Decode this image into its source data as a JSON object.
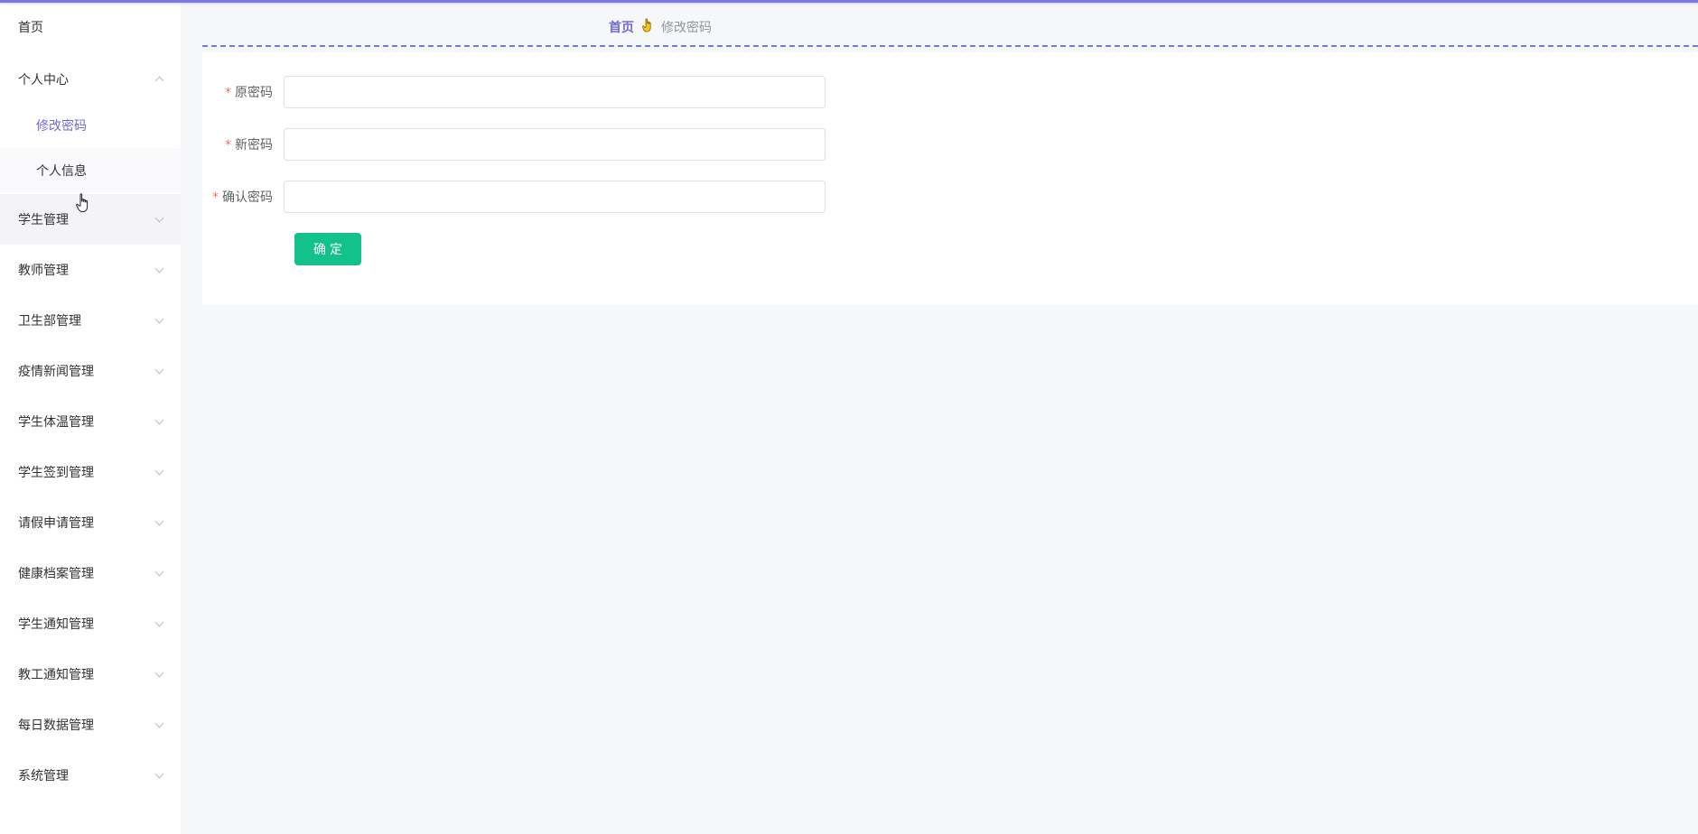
{
  "sidebar": {
    "home": "首页",
    "personal_center": "个人中心",
    "sub_items": [
      "修改密码",
      "个人信息"
    ],
    "items": [
      "学生管理",
      "教师管理",
      "卫生部管理",
      "疫情新闻管理",
      "学生体温管理",
      "学生签到管理",
      "请假申请管理",
      "健康档案管理",
      "学生通知管理",
      "教工通知管理",
      "每日数据管理",
      "系统管理"
    ]
  },
  "breadcrumb": {
    "home": "首页",
    "separator_icon": "hand-pointing-icon",
    "current": "修改密码"
  },
  "form": {
    "required_mark": "*",
    "old_password_label": "原密码",
    "new_password_label": "新密码",
    "confirm_password_label": "确认密码",
    "old_password_value": "",
    "new_password_value": "",
    "confirm_password_value": "",
    "submit_label": "确定"
  },
  "colors": {
    "accent": "#7b78e6",
    "active_text": "#6f6ad8",
    "button": "#13c28b",
    "required": "#f56c6c"
  }
}
